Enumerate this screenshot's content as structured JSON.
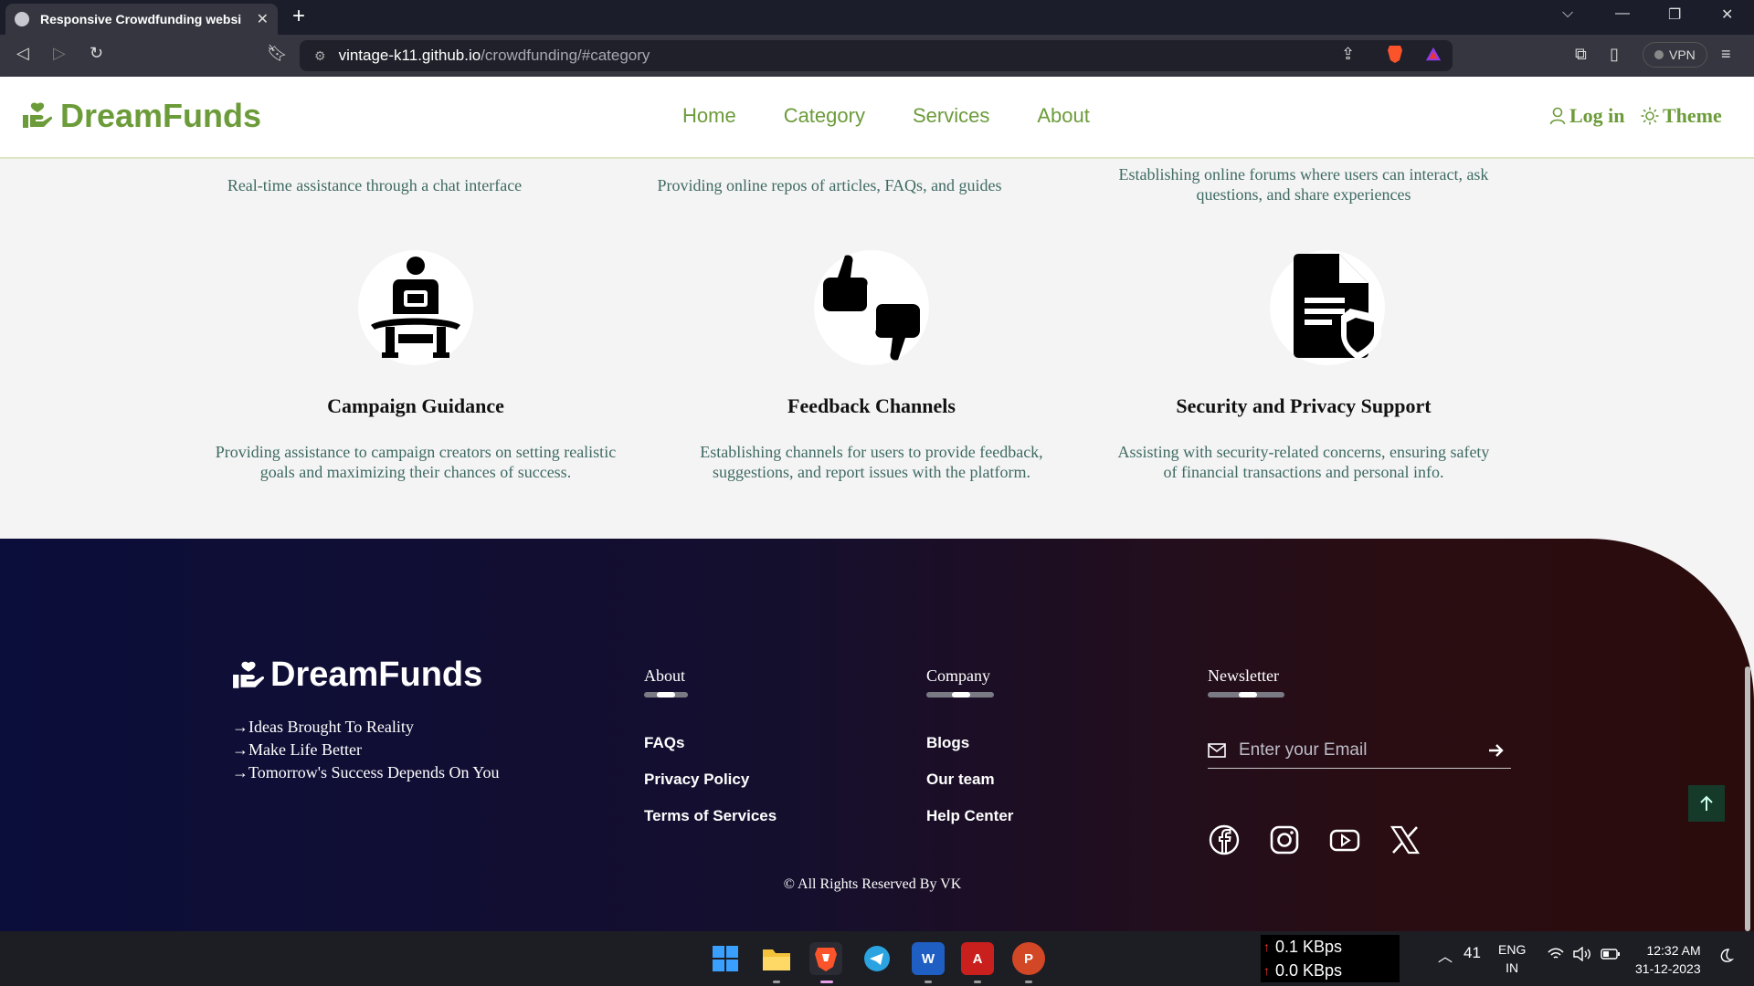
{
  "browser": {
    "tab_title": "Responsive Crowdfunding websi",
    "url_host": "vintage-k11.github.io",
    "url_path": "/crowdfunding/#category",
    "vpn_label": "VPN"
  },
  "site": {
    "logo_text": "DreamFunds",
    "nav": [
      "Home",
      "Category",
      "Services",
      "About"
    ],
    "login_label": "Log in",
    "theme_label": "Theme",
    "brand_color": "#6c9b3a"
  },
  "services_top": [
    "Real-time assistance through a chat interface",
    "Providing online repos of articles, FAQs, and guides",
    "Establishing online forums where users can interact, ask questions, and share experiences"
  ],
  "services": [
    {
      "icon": "person-reading-icon",
      "title": "Campaign Guidance",
      "desc": "Providing assistance to campaign creators on setting realistic goals and maximizing their chances of success."
    },
    {
      "icon": "thumbs-up-down-icon",
      "title": "Feedback Channels",
      "desc": "Establishing channels for users to provide feedback, suggestions, and report issues with the platform."
    },
    {
      "icon": "document-shield-icon",
      "title": "Security and Privacy Support",
      "desc": "Assisting with security-related concerns, ensuring safety of financial transactions and personal info."
    }
  ],
  "footer": {
    "logo_text": "DreamFunds",
    "taglines": [
      "→Ideas Brought To Reality",
      "→Make Life Better",
      "→Tomorrow's Success Depends On You"
    ],
    "about_heading": "About",
    "about_links": [
      "FAQs",
      "Privacy Policy",
      "Terms of Services"
    ],
    "company_heading": "Company",
    "company_links": [
      "Blogs",
      "Our team",
      "Help Center"
    ],
    "newsletter_heading": "Newsletter",
    "email_placeholder": "Enter your Email",
    "socials": [
      "facebook-icon",
      "instagram-icon",
      "youtube-icon",
      "x-icon"
    ],
    "copyright": "© All Rights Reserved By VK"
  },
  "taskbar": {
    "apps": [
      "windows-start-icon",
      "file-explorer-icon",
      "brave-icon",
      "telegram-icon",
      "word-icon",
      "acrobat-icon",
      "powerpoint-icon"
    ],
    "upload": "0.1 KBps",
    "download": "0.0 KBps",
    "temp": "41",
    "lang": "ENG",
    "region": "IN",
    "time": "12:32 AM",
    "date": "31-12-2023"
  }
}
